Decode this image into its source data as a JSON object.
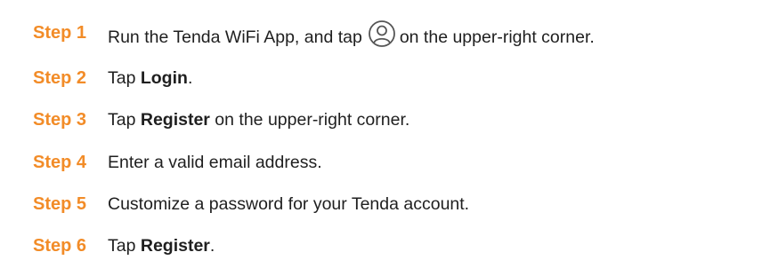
{
  "steps": [
    {
      "label": "Step 1",
      "text_before": "Run the Tenda WiFi App, and tap",
      "icon": "user-account-icon",
      "text_after": "on the upper-right corner."
    },
    {
      "label": "Step 2",
      "text_before": "Tap ",
      "bold": "Login",
      "text_after": "."
    },
    {
      "label": "Step 3",
      "text_before": "Tap ",
      "bold": "Register",
      "text_after": " on the upper-right corner."
    },
    {
      "label": "Step 4",
      "text": "Enter a valid email address."
    },
    {
      "label": "Step 5",
      "text": "Customize a password for your Tenda account."
    },
    {
      "label": "Step 6",
      "text_before": "Tap ",
      "bold": "Register",
      "text_after": "."
    }
  ],
  "colors": {
    "step_label": "#f28c28",
    "body_text": "#1f1f1f",
    "icon_stroke": "#555555"
  }
}
